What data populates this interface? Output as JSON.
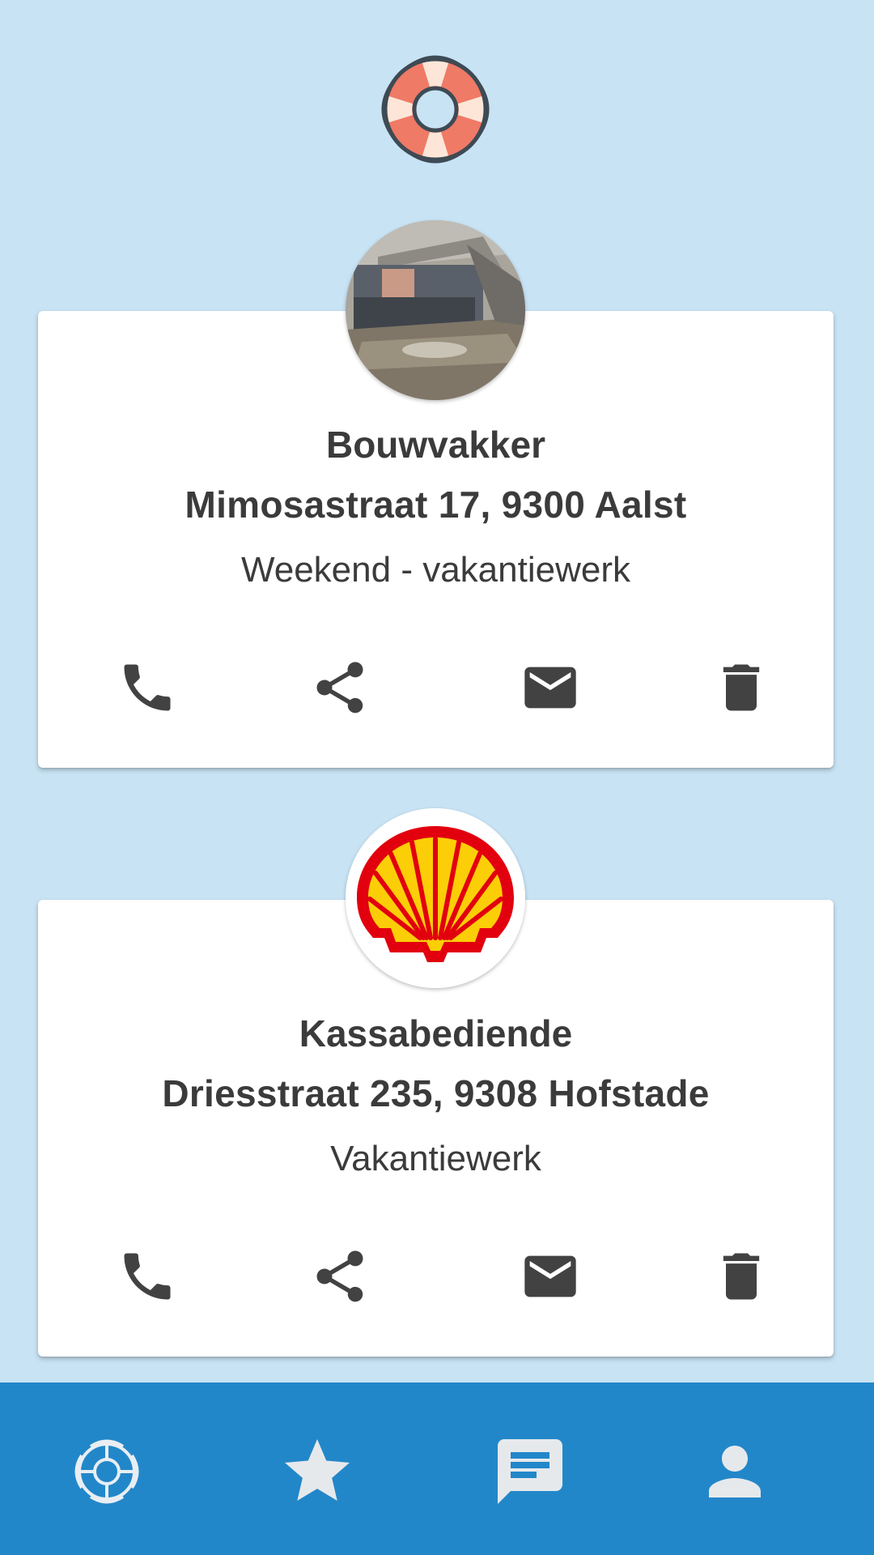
{
  "header": {
    "logo_icon": "lifebuoy-icon"
  },
  "jobs": [
    {
      "title": "Bouwvakker",
      "address": "Mimosastraat 17, 9300 Aalst",
      "type": "Weekend - vakantiewerk",
      "avatar": "construction-site-photo"
    },
    {
      "title": "Kassabediende",
      "address": "Driesstraat 235, 9308 Hofstade",
      "type": "Vakantiewerk",
      "avatar": "shell-logo"
    }
  ],
  "card_actions": [
    "phone-icon",
    "share-icon",
    "mail-icon",
    "delete-icon"
  ],
  "bottom_nav": {
    "items": [
      "lifebuoy-icon",
      "star-icon",
      "chat-icon",
      "person-icon"
    ]
  },
  "colors": {
    "background": "#c8e3f4",
    "nav_background": "#2287c9",
    "icon": "#424242",
    "text": "#3b3b3b",
    "lifebuoy_red": "#ef7a66"
  }
}
